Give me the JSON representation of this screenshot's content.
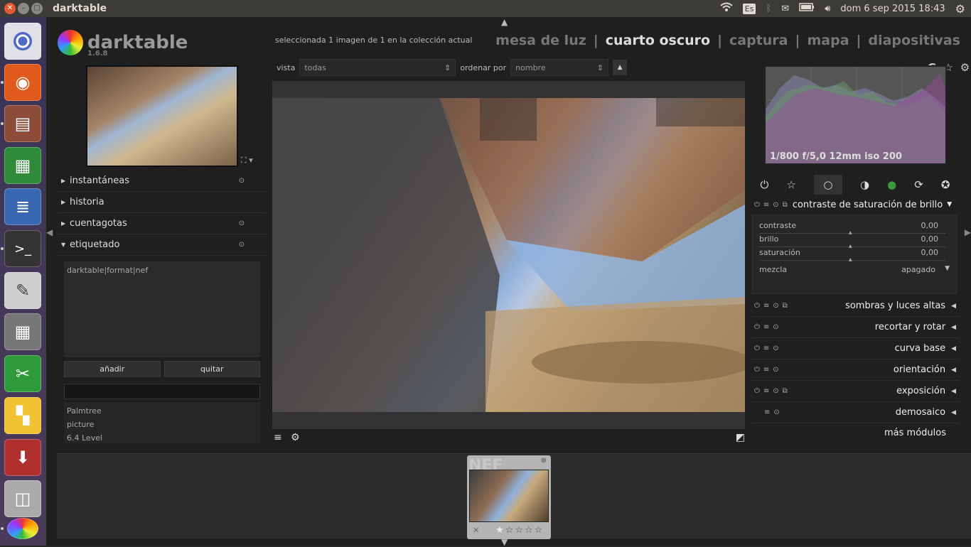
{
  "window": {
    "title": "darktable"
  },
  "system": {
    "keyboard": "Es",
    "datetime": "dom  6 sep 2015 18:43"
  },
  "app": {
    "name": "darktable",
    "version": "1.6.8"
  },
  "header": {
    "selection_text": "seleccionada 1 imagen de 1 en la colección actual",
    "views": [
      "mesa de luz",
      "cuarto oscuro",
      "captura",
      "mapa",
      "diapositivas"
    ],
    "active_view": "cuarto oscuro",
    "separator": "|"
  },
  "filter": {
    "view_label": "vista",
    "view_value": "todas",
    "sort_label": "ordenar por",
    "sort_value": "nombre",
    "sort_dir": "▲",
    "grouping": "G"
  },
  "left_panel": {
    "modules": [
      "instantáneas",
      "historia",
      "cuentagotas",
      "etiquetado"
    ],
    "attached_tags": "darktable|format|nef",
    "add_button": "añadir",
    "remove_button": "quitar",
    "tag_dictionary": [
      "Palmtree",
      "picture",
      "6.4 Level"
    ]
  },
  "histogram": {
    "info": "1/800 f/5,0 12mm iso 200"
  },
  "right_panel": {
    "expanded_module": "contraste de saturación de brillo",
    "sliders": [
      {
        "label": "contraste",
        "value": "0,00"
      },
      {
        "label": "brillo",
        "value": "0,00"
      },
      {
        "label": "saturación",
        "value": "0,00"
      }
    ],
    "blend_label": "mezcla",
    "blend_value": "apagado",
    "modules": [
      "sombras y luces altas",
      "recortar y rotar",
      "curva base",
      "orientación",
      "exposición",
      "demosaico"
    ],
    "more_modules": "más módulos"
  },
  "filmstrip": {
    "ext": "NEF",
    "rating": 1,
    "max_rating": 5
  }
}
